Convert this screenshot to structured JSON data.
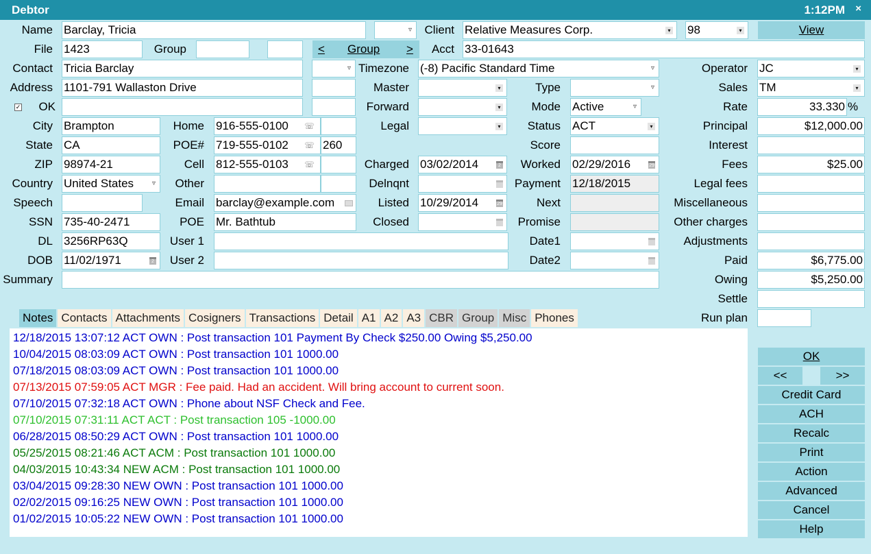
{
  "window": {
    "title": "Debtor",
    "clock": "1:12PM",
    "close": "×"
  },
  "labels": {
    "name": "Name",
    "file": "File",
    "group": "Group",
    "contact": "Contact",
    "address": "Address",
    "ok": "OK",
    "city": "City",
    "state": "State",
    "zip": "ZIP",
    "country": "Country",
    "speech": "Speech",
    "ssn": "SSN",
    "dl": "DL",
    "dob": "DOB",
    "summary": "Summary",
    "home": "Home",
    "poe_num": "POE#",
    "cell": "Cell",
    "other": "Other",
    "email": "Email",
    "poe": "POE",
    "user1": "User 1",
    "user2": "User 2",
    "client": "Client",
    "acct": "Acct",
    "timezone": "Timezone",
    "master": "Master",
    "forward": "Forward",
    "legal": "Legal",
    "charged": "Charged",
    "delnqnt": "Delnqnt",
    "listed": "Listed",
    "closed": "Closed",
    "type": "Type",
    "mode": "Mode",
    "status": "Status",
    "score": "Score",
    "worked": "Worked",
    "payment": "Payment",
    "next": "Next",
    "promise": "Promise",
    "date1": "Date1",
    "date2": "Date2",
    "operator": "Operator",
    "sales": "Sales",
    "rate": "Rate",
    "principal": "Principal",
    "interest": "Interest",
    "fees": "Fees",
    "legal_fees": "Legal fees",
    "miscellaneous": "Miscellaneous",
    "other_charges": "Other charges",
    "adjustments": "Adjustments",
    "paid": "Paid",
    "owing": "Owing",
    "settle": "Settle",
    "run_plan": "Run plan",
    "percent": "%"
  },
  "fields": {
    "name": "Barclay, Tricia",
    "file": "1423",
    "group1": "",
    "group2": "",
    "contact": "Tricia Barclay",
    "address": "1101-791 Wallaston Drive",
    "address2": "",
    "ok_checked": "✓",
    "city": "Brampton",
    "state": "CA",
    "zip": "98974-21",
    "country": "United States",
    "speech": "",
    "ssn": "735-40-2471",
    "dl": "3256RP63Q",
    "dob": "11/02/1971",
    "summary": "",
    "home": "916-555-0100",
    "home_ext": "",
    "poe_phone": "719-555-0102",
    "poe_ext": "260",
    "cell": "812-555-0103",
    "cell_ext": "",
    "other": "",
    "other_ext": "",
    "email": "barclay@example.com",
    "poe": "Mr. Bathtub",
    "user1": "",
    "user2": "",
    "client": "Relative Measures Corp.",
    "client_code": "98",
    "acct": "33-01643",
    "timezone": "(-8) Pacific Standard Time",
    "master": "",
    "forward": "",
    "legal": "",
    "charged": "03/02/2014",
    "delnqnt": "",
    "listed": "10/29/2014",
    "closed": "",
    "type": "",
    "mode": "Active",
    "status": "ACT",
    "score": "",
    "worked": "02/29/2016",
    "payment": "12/18/2015",
    "next": "",
    "promise": "",
    "date1": "",
    "date2": "",
    "operator": "JC",
    "sales": "TM",
    "rate": "33.330",
    "principal": "$12,000.00",
    "interest": "",
    "fees": "$25.00",
    "legal_fees": "",
    "miscellaneous": "",
    "other_charges": "",
    "adjustments": "",
    "paid": "$6,775.00",
    "owing": "$5,250.00",
    "settle": "",
    "run_plan": ""
  },
  "group_nav": {
    "prev": "<",
    "label": "Group",
    "next": ">"
  },
  "view_button": "View",
  "tabs": [
    {
      "label": "Notes",
      "style": "active"
    },
    {
      "label": "Contacts",
      "style": ""
    },
    {
      "label": "Attachments",
      "style": ""
    },
    {
      "label": "Cosigners",
      "style": ""
    },
    {
      "label": "Transactions",
      "style": ""
    },
    {
      "label": "Detail",
      "style": ""
    },
    {
      "label": "A1",
      "style": ""
    },
    {
      "label": "A2",
      "style": ""
    },
    {
      "label": "A3",
      "style": ""
    },
    {
      "label": "CBR",
      "style": "gray"
    },
    {
      "label": "Group",
      "style": "gray"
    },
    {
      "label": "Misc",
      "style": "gray"
    },
    {
      "label": "Phones",
      "style": ""
    }
  ],
  "notes": [
    {
      "text": "12/18/2015 13:07:12 ACT OWN : Post transaction 101 Payment By Check $250.00 Owing $5,250.00",
      "color": "#0000cc"
    },
    {
      "text": "10/04/2015 08:03:09 ACT OWN : Post transaction 101 1000.00",
      "color": "#0000cc"
    },
    {
      "text": "07/18/2015 08:03:09 ACT OWN : Post transaction 101 1000.00",
      "color": "#0000cc"
    },
    {
      "text": "07/13/2015 07:59:05 ACT MGR : Fee paid. Had an accident. Will bring account to current soon.",
      "color": "#e01010"
    },
    {
      "text": "07/10/2015 07:32:18 ACT OWN : Phone about NSF Check and Fee.",
      "color": "#0000cc"
    },
    {
      "text": "07/10/2015 07:31:11 ACT ACT : Post transaction 105 -1000.00",
      "color": "#2ec02e"
    },
    {
      "text": "06/28/2015 08:50:29 ACT OWN : Post transaction 101 1000.00",
      "color": "#0000cc"
    },
    {
      "text": "05/25/2015 08:21:46 ACT ACM : Post transaction 101 1000.00",
      "color": "#0a7a0a"
    },
    {
      "text": "04/03/2015 10:43:34 NEW ACM : Post transaction 101 1000.00",
      "color": "#0a7a0a"
    },
    {
      "text": "03/04/2015 09:28:30 NEW OWN : Post transaction 101 1000.00",
      "color": "#0000cc"
    },
    {
      "text": "02/02/2015 09:16:25 NEW OWN : Post transaction 101 1000.00",
      "color": "#0000cc"
    },
    {
      "text": "01/02/2015 10:05:22 NEW OWN : Post transaction 101 1000.00",
      "color": "#0000cc"
    }
  ],
  "buttons": {
    "ok": "OK",
    "prev": "<<",
    "next": ">>",
    "credit_card": "Credit Card",
    "ach": "ACH",
    "recalc": "Recalc",
    "print": "Print",
    "action": "Action",
    "advanced": "Advanced",
    "cancel": "Cancel",
    "help": "Help"
  },
  "icons": {
    "dropdown": "▿",
    "dropdown_filled": "▾",
    "phone": "☏",
    "calendar_day": "2",
    "calendar_29": "29"
  }
}
